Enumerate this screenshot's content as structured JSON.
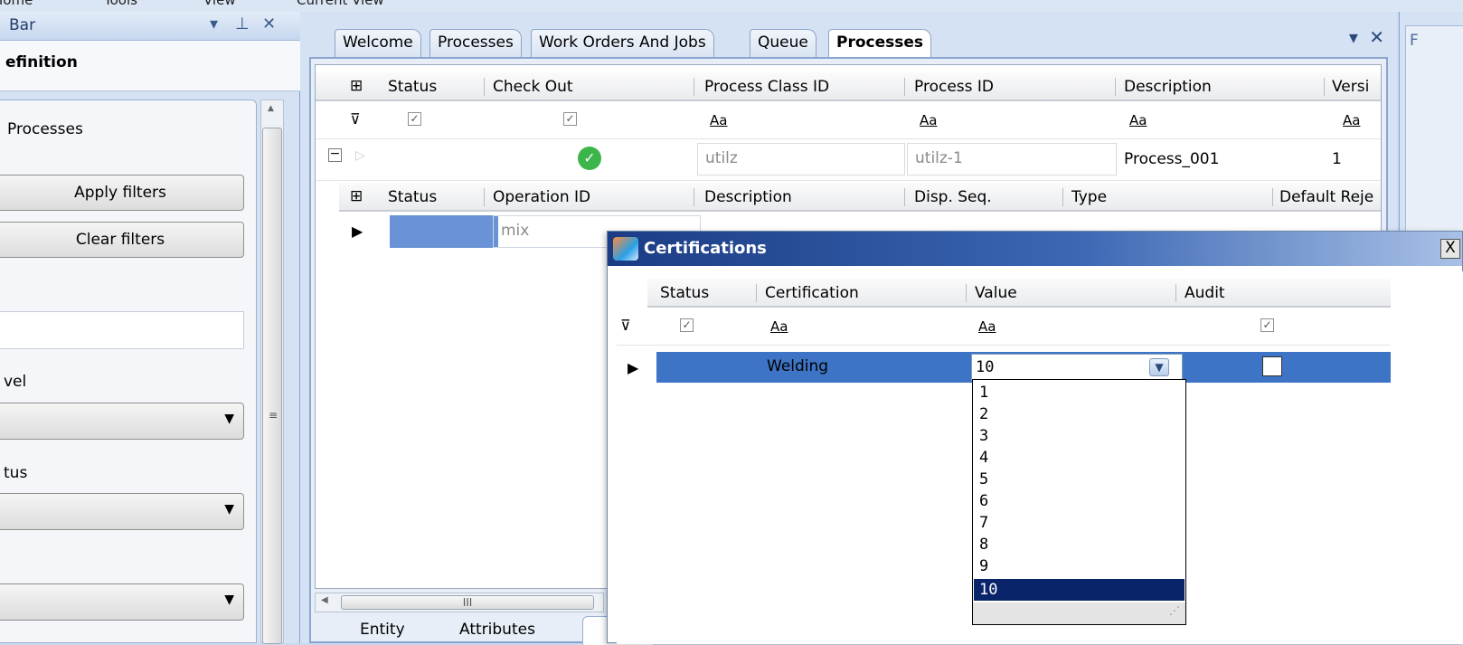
{
  "menubar": {
    "items": [
      "Home",
      "Tools",
      "View",
      "Current View"
    ]
  },
  "left_panel": {
    "title": "Bar",
    "section_title": "efinition",
    "processes_label": "Processes",
    "apply_button": "Apply filters",
    "clear_button": "Clear filters",
    "level_label": "vel",
    "status_label": "tus"
  },
  "tabs": [
    {
      "label": "Welcome"
    },
    {
      "label": "Processes"
    },
    {
      "label": "Work Orders And Jobs"
    },
    {
      "label": "Queue"
    },
    {
      "label": "Processes"
    }
  ],
  "process_grid": {
    "columns": [
      "Status",
      "Check Out",
      "Process Class ID",
      "Process ID",
      "Description",
      "Versi"
    ],
    "filter_text": "Aa",
    "row": {
      "process_class_id": "utilz",
      "process_id": "utilz-1",
      "description": "Process_001",
      "version": "1"
    }
  },
  "operations_grid": {
    "columns": [
      "Status",
      "Operation ID",
      "Description",
      "Disp. Seq.",
      "Type",
      "Default Reje"
    ],
    "row": {
      "operation_id": "mix"
    }
  },
  "bottom_tabs": [
    "Entity",
    "Attributes"
  ],
  "scroll_thumb_grip": "III",
  "right_strip_label": "F",
  "dialog": {
    "title": "Certifications",
    "close_label": "X",
    "columns": [
      "Status",
      "Certification",
      "Value",
      "Audit"
    ],
    "filter_text": "Aa",
    "row": {
      "certification": "Welding",
      "value": "10"
    },
    "value_options": [
      "1",
      "2",
      "3",
      "4",
      "5",
      "6",
      "7",
      "8",
      "9",
      "10"
    ],
    "selected_option": "10"
  },
  "colors": {
    "selection_blue": "#3e74c6",
    "list_highlight": "#0a246a",
    "dialog_title_start": "#1b3c84",
    "dialog_title_end": "#a9c1e6",
    "check_green": "#3cb54a"
  },
  "icons": {
    "filter_row": "filter-icon",
    "column_chooser": "column-chooser-icon",
    "checked_out": "green-check-icon",
    "collapse": "collapse-icon",
    "row_indicator": "row-pointer-icon",
    "dialog_app": "app-icon",
    "dropdown": "chevron-down-icon",
    "pin": "pin-icon",
    "close": "close-icon"
  }
}
